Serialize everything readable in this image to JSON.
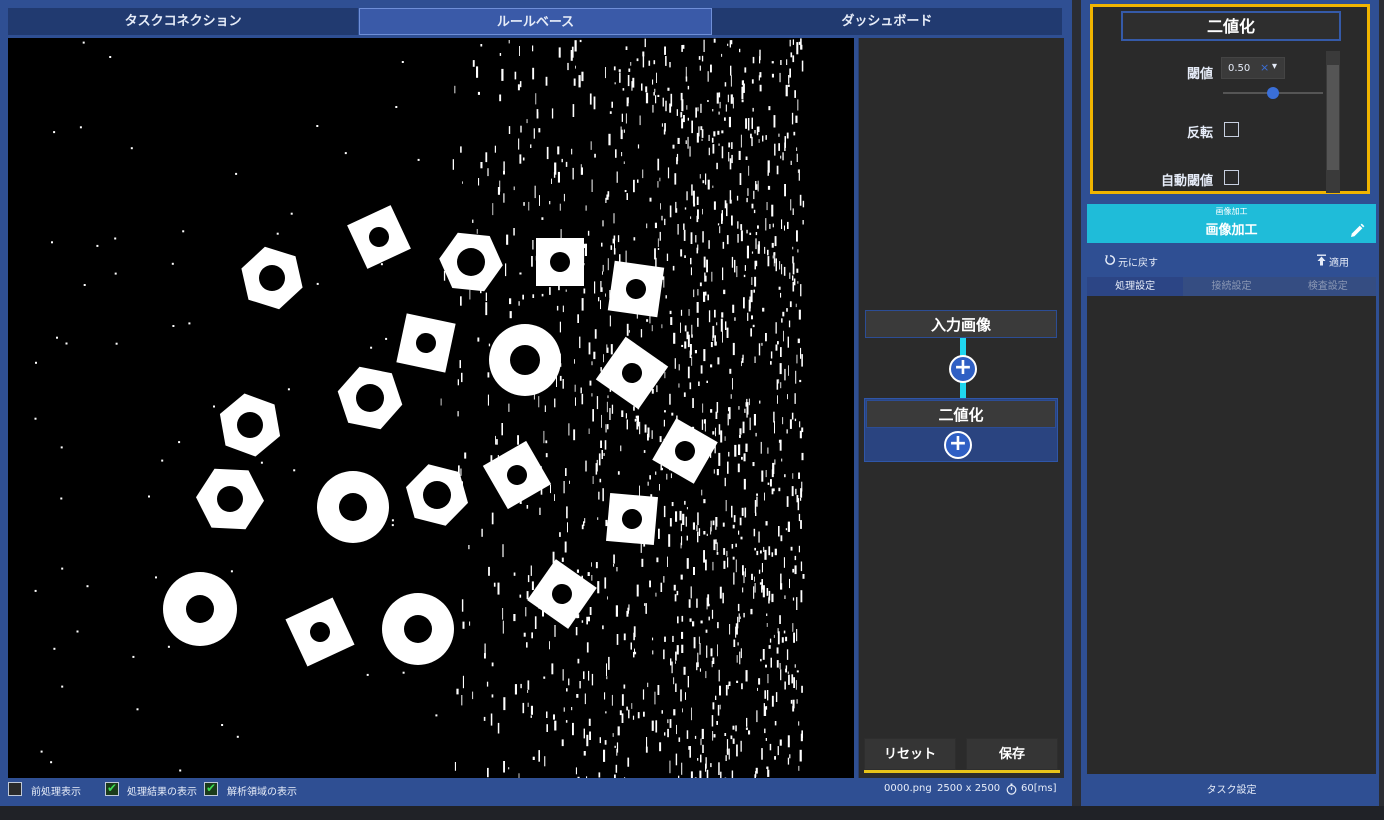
{
  "tabs": [
    {
      "label": "タスクコネクション",
      "active": false
    },
    {
      "label": "ルールベース",
      "active": true
    },
    {
      "label": "ダッシュボード",
      "active": false
    }
  ],
  "flow": {
    "input_node": "入力画像",
    "binarize_node": "二値化",
    "reset_label": "リセット",
    "save_label": "保存"
  },
  "status": {
    "preprocess_label": "前処理表示",
    "preprocess_checked": false,
    "result_label": "処理結果の表示",
    "result_checked": true,
    "roi_label": "解析領域の表示",
    "roi_checked": true,
    "filename": "0000.png",
    "resolution": "2500 x 2500",
    "timing": "60[ms]"
  },
  "settings": {
    "title": "二値化",
    "threshold_label": "閾値",
    "threshold_value": "0.50",
    "threshold_fraction": 0.5,
    "invert_label": "反転",
    "invert_checked": false,
    "auto_threshold_label": "自動閾値",
    "auto_threshold_checked": false
  },
  "processing": {
    "small_header": "画像加工",
    "header": "画像加工",
    "undo_label": "元に戻す",
    "apply_label": "適用",
    "subtabs": [
      {
        "label": "処理設定",
        "active": true
      },
      {
        "label": "接続設定",
        "active": false
      },
      {
        "label": "検査設定",
        "active": false
      }
    ],
    "task_setting_label": "タスク設定"
  },
  "colors": {
    "panel_blue": "#2f4f93",
    "accent_cyan": "#1fbcd9",
    "highlight_yellow": "#f0b400",
    "check_green": "#3ddc55"
  }
}
